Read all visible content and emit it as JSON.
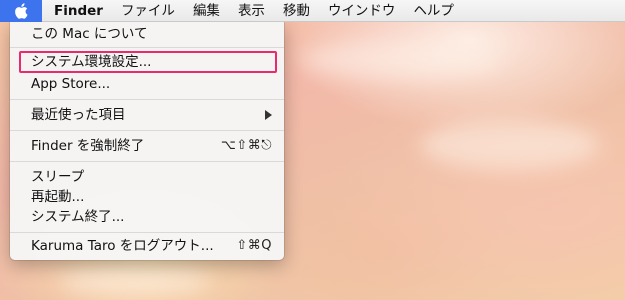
{
  "menubar": {
    "apple_icon": "apple-logo-icon",
    "app_name": "Finder",
    "items": [
      "ファイル",
      "編集",
      "表示",
      "移動",
      "ウインドウ",
      "ヘルプ"
    ]
  },
  "apple_menu": {
    "about": "この Mac について",
    "system_preferences": "システム環境設定...",
    "app_store": "App Store...",
    "recent_items": "最近使った項目",
    "force_quit": {
      "label": "Finder を強制終了",
      "shortcut": "⌥⇧⌘⎋"
    },
    "sleep": "スリープ",
    "restart": "再起動...",
    "shut_down": "システム終了...",
    "log_out": {
      "label": "Karuma Taro をログアウト...",
      "shortcut": "⇧⌘Q"
    }
  },
  "colors": {
    "highlight_outline": "#ea2a6f",
    "apple_menu_active": "#3d73ec"
  }
}
